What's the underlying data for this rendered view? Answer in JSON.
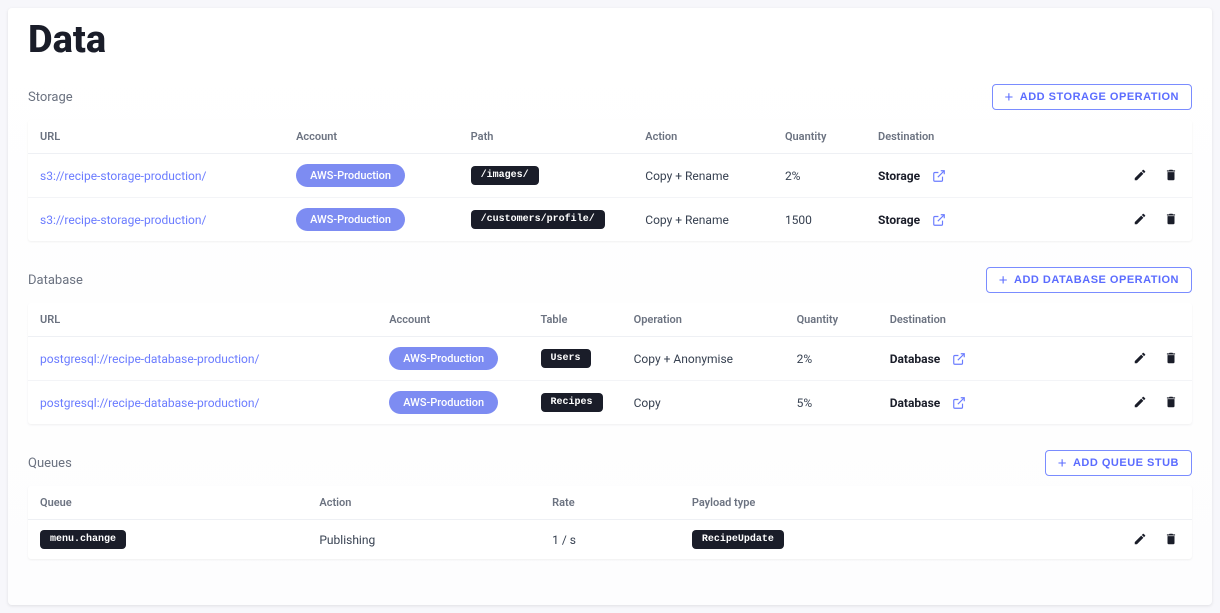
{
  "page_title": "Data",
  "storage": {
    "title": "Storage",
    "add_button": "ADD STORAGE OPERATION",
    "headers": {
      "url": "URL",
      "account": "Account",
      "path": "Path",
      "action": "Action",
      "quantity": "Quantity",
      "destination": "Destination"
    },
    "rows": [
      {
        "url": "s3://recipe-storage-production/",
        "account": "AWS-Production",
        "path": "/images/",
        "action": "Copy + Rename",
        "quantity": "2%",
        "destination": "Storage"
      },
      {
        "url": "s3://recipe-storage-production/",
        "account": "AWS-Production",
        "path": "/customers/profile/",
        "action": "Copy + Rename",
        "quantity": "1500",
        "destination": "Storage"
      }
    ]
  },
  "database": {
    "title": "Database",
    "add_button": "ADD DATABASE OPERATION",
    "headers": {
      "url": "URL",
      "account": "Account",
      "table": "Table",
      "operation": "Operation",
      "quantity": "Quantity",
      "destination": "Destination"
    },
    "rows": [
      {
        "url": "postgresql://recipe-database-production/",
        "account": "AWS-Production",
        "table": "Users",
        "operation": "Copy + Anonymise",
        "quantity": "2%",
        "destination": "Database"
      },
      {
        "url": "postgresql://recipe-database-production/",
        "account": "AWS-Production",
        "table": "Recipes",
        "operation": "Copy",
        "quantity": "5%",
        "destination": "Database"
      }
    ]
  },
  "queues": {
    "title": "Queues",
    "add_button": "ADD QUEUE STUB",
    "headers": {
      "queue": "Queue",
      "action": "Action",
      "rate": "Rate",
      "payload_type": "Payload type"
    },
    "rows": [
      {
        "queue": "menu.change",
        "action": "Publishing",
        "rate": "1 / s",
        "payload_type": "RecipeUpdate"
      }
    ]
  }
}
